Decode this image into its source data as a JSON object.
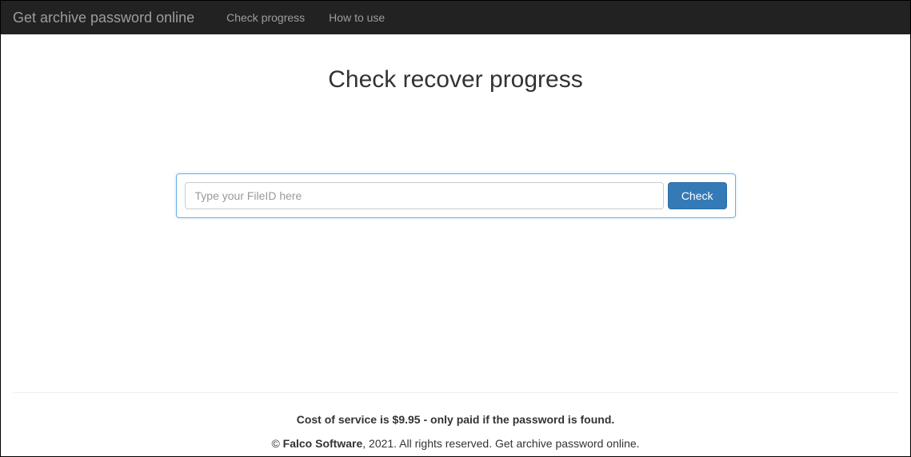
{
  "navbar": {
    "brand": "Get archive password online",
    "links": {
      "check_progress": "Check progress",
      "how_to_use": "How to use"
    }
  },
  "main": {
    "title": "Check recover progress",
    "input_placeholder": "Type your FileID here",
    "input_value": "",
    "check_button": "Check"
  },
  "footer": {
    "cost_line": "Cost of service is $9.95 - only paid if the password is found.",
    "copyright_symbol": "© ",
    "company": "Falco Software",
    "rights": ", 2021. All rights reserved. Get archive password online."
  }
}
